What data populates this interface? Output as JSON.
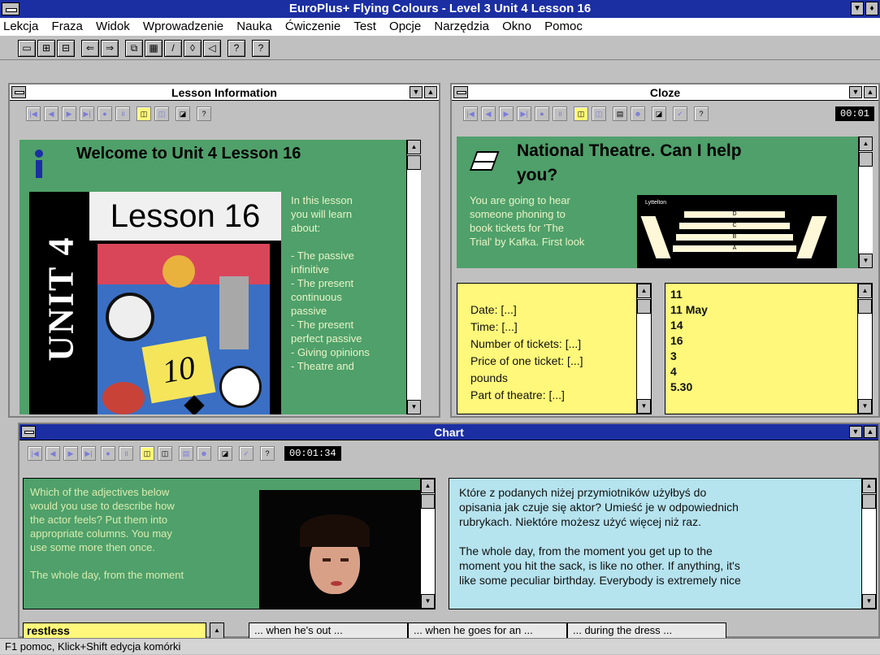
{
  "app": {
    "title": "EuroPlus+ Flying Colours - Level 3 Unit 4 Lesson 16"
  },
  "menu": [
    "Lekcja",
    "Fraza",
    "Widok",
    "Wprowadzenie",
    "Nauka",
    "Ćwiczenie",
    "Test",
    "Opcje",
    "Narzędzia",
    "Okno",
    "Pomoc"
  ],
  "lesson_info": {
    "title": "Lesson Information",
    "heading": "Welcome to Unit 4 Lesson 16",
    "book_unit": "UNIT 4",
    "book_lesson": "Lesson 16",
    "badge": "10",
    "text_lines": [
      "In this lesson",
      "you will learn",
      "about:",
      "",
      "- The passive",
      "infinitive",
      "- The present",
      "continuous",
      "passive",
      "- The present",
      "perfect passive",
      "- Giving opinions",
      "- Theatre and"
    ]
  },
  "cloze": {
    "title": "Cloze",
    "timer": "00:01",
    "heading_1": "National Theatre. Can I help",
    "heading_2": "you?",
    "body_lines": [
      "You are going to hear",
      "someone phoning to",
      "book tickets for 'The",
      "Trial' by Kafka. First look"
    ],
    "image_label": "Lyttelton",
    "rows": [
      "D",
      "C",
      "B",
      "A"
    ],
    "fields": [
      "Date: [...]",
      "Time: [...]",
      "Number of tickets: [...]",
      "Price of one ticket: [...]",
      "pounds",
      "Part of theatre: [...]"
    ],
    "answers": [
      "11",
      "11 May",
      "14",
      "16",
      "3",
      "4",
      "5.30"
    ]
  },
  "chart": {
    "title": "Chart",
    "timer": "00:01:34",
    "left_lines": [
      "Which of the adjectives below",
      "would you use to describe how",
      "the actor feels? Put them into",
      "appropriate columns. You may",
      "use some more then once.",
      "",
      "The whole day, from the moment"
    ],
    "right_lines": [
      "Które z podanych niżej przymiotników użyłbyś do",
      "opisania jak czuje się aktor? Umieść je w odpowiednich",
      "rubrykach. Niektóre możesz użyć więcej niż raz.",
      "",
      "The whole day, from the moment you get up to the",
      "moment you hit the sack, is like no other. If anything, it's",
      "like some peculiar birthday. Everybody is extremely nice"
    ],
    "word": "restless",
    "columns": [
      "... when he's out ...",
      "... when he goes for an ...",
      "... during the dress ..."
    ]
  },
  "status": "F1 pomoc, Klick+Shift edycja komórki",
  "colors": {
    "titlebar": "#1b2fa3",
    "green": "#4fa06a",
    "yellow": "#fff87a",
    "cyan": "#b5e3ee"
  }
}
